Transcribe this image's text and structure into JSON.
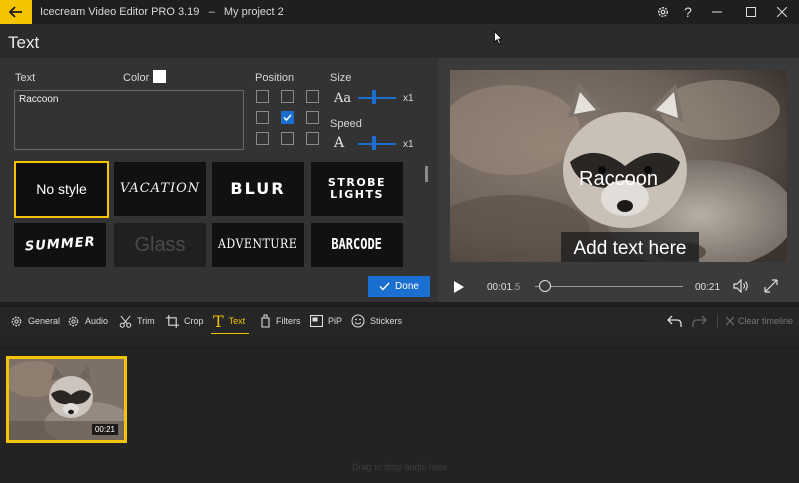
{
  "titlebar": {
    "app_name": "Icecream Video Editor PRO 3.19",
    "separator": "–",
    "project": "My project 2",
    "icons": [
      "back-arrow-icon",
      "gear-icon",
      "help-icon",
      "minimize-icon",
      "maximize-icon",
      "close-icon"
    ]
  },
  "header": {
    "title": "Text"
  },
  "text_panel": {
    "text_label": "Text",
    "text_value": "Raccoon",
    "color_label": "Color",
    "color_value": "#ffffff",
    "position_label": "Position",
    "position_selected": "center",
    "size_label": "Size",
    "size_multiplier": "x1",
    "speed_label": "Speed",
    "speed_multiplier": "x1",
    "styles": [
      {
        "label": "No style"
      },
      {
        "label": "VACATION"
      },
      {
        "label": "BLUR"
      },
      {
        "label": "STROBE LIGHTS"
      },
      {
        "label": "SUMMER"
      },
      {
        "label": "Glass"
      },
      {
        "label": "ADVENTURE"
      },
      {
        "label": "BARCODE"
      }
    ],
    "selected_style": "No style",
    "done_label": "Done"
  },
  "preview": {
    "overlay_text": "Raccoon",
    "placeholder_box_text": "Add text here",
    "current_time": "00:01.5",
    "current_time_main": "00:01",
    "current_time_frac": ".5",
    "duration": "00:21",
    "progress_fraction": 0.07
  },
  "toolbar": {
    "tools": [
      {
        "label": "General",
        "icon": "gear-icon"
      },
      {
        "label": "Audio",
        "icon": "gear-icon"
      },
      {
        "label": "Trim",
        "icon": "scissors-icon"
      },
      {
        "label": "Crop",
        "icon": "crop-icon"
      },
      {
        "label": "Text",
        "icon": "text-icon",
        "active": true
      },
      {
        "label": "Filters",
        "icon": "filters-icon"
      },
      {
        "label": "PiP",
        "icon": "pip-icon"
      },
      {
        "label": "Stickers",
        "icon": "sticker-icon"
      }
    ],
    "clear_label": "Clear timeline"
  },
  "timeline": {
    "clip_duration": "00:21",
    "audio_hint": "Drag to drop audio here"
  },
  "colors": {
    "accent": "#f5c400",
    "primary_button": "#1a6fd1"
  }
}
